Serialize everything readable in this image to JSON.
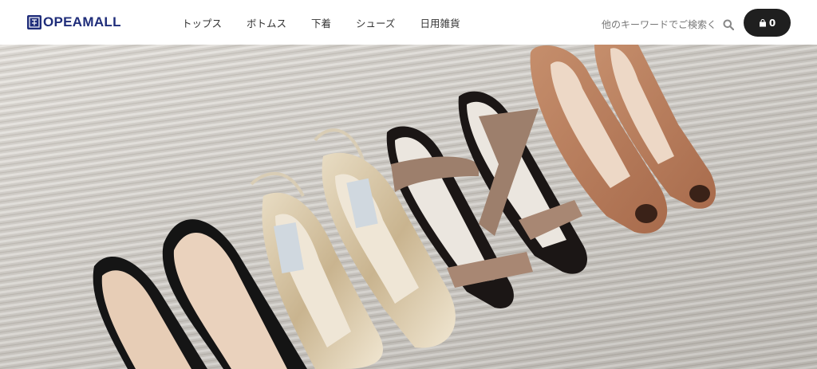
{
  "brand": {
    "logo_text": "OPEAMALL"
  },
  "nav": {
    "items": [
      {
        "label": "トップス"
      },
      {
        "label": "ボトムス"
      },
      {
        "label": "下着"
      },
      {
        "label": "シューズ"
      },
      {
        "label": "日用雑貨"
      }
    ]
  },
  "search": {
    "placeholder": "他のキーワードでご検索く",
    "icon": "search-icon"
  },
  "cart": {
    "icon": "shopping-bag-icon",
    "count": "0"
  },
  "hero": {
    "image": "row of women's high heel shoes on a carpet"
  },
  "colors": {
    "brand": "#1f2d7a",
    "cart_bg": "#1f1f1f"
  }
}
